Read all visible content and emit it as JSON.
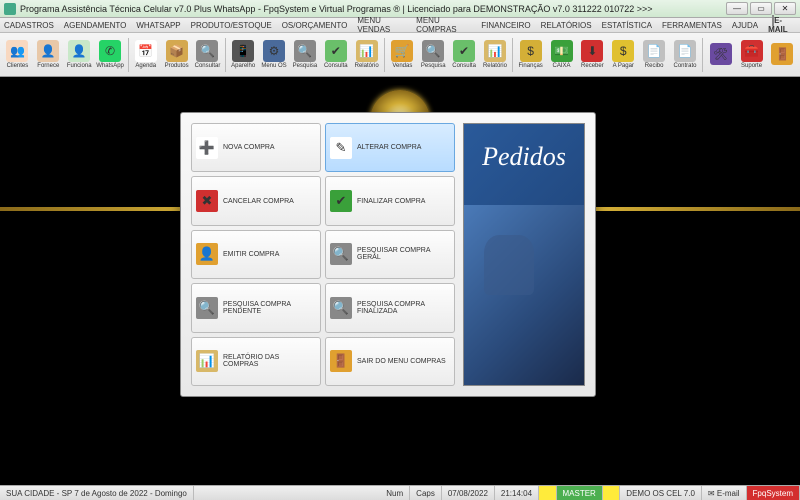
{
  "title": "Programa Assistência Técnica Celular v7.0 Plus WhatsApp - FpqSystem e Virtual Programas ® | Licenciado para  DEMONSTRAÇÃO v7.0 311222 010722 >>>",
  "menu": [
    "CADASTROS",
    "AGENDAMENTO",
    "WHATSAPP",
    "PRODUTO/ESTOQUE",
    "OS/ORÇAMENTO",
    "MENU VENDAS",
    "MENU COMPRAS",
    "FINANCEIRO",
    "RELATÓRIOS",
    "ESTATÍSTICA",
    "FERRAMENTAS",
    "AJUDA"
  ],
  "email_label": "E-MAIL",
  "toolbar": [
    {
      "label": "Clientes",
      "bg": "#f8d8c0",
      "glyph": "👥"
    },
    {
      "label": "Fornece",
      "bg": "#e8c8a8",
      "glyph": "👤"
    },
    {
      "label": "Funciona",
      "bg": "#c8e8c8",
      "glyph": "👤"
    },
    {
      "label": "WhatsApp",
      "bg": "#25d366",
      "glyph": "✆"
    },
    {
      "label": "Agenda",
      "bg": "#ffffff",
      "glyph": "📅"
    },
    {
      "label": "Produtos",
      "bg": "#d4a850",
      "glyph": "📦"
    },
    {
      "label": "Consultar",
      "bg": "#888888",
      "glyph": "🔍"
    },
    {
      "label": "Aparelho",
      "bg": "#555555",
      "glyph": "📱"
    },
    {
      "label": "Menu OS",
      "bg": "#4a6a9a",
      "glyph": "⚙"
    },
    {
      "label": "Pesquisa",
      "bg": "#888888",
      "glyph": "🔍"
    },
    {
      "label": "Consulta",
      "bg": "#6abf6a",
      "glyph": "✔"
    },
    {
      "label": "Relatório",
      "bg": "#d8b868",
      "glyph": "📊"
    },
    {
      "label": "Vendas",
      "bg": "#e0a030",
      "glyph": "🛒"
    },
    {
      "label": "Pesquisa",
      "bg": "#888888",
      "glyph": "🔍"
    },
    {
      "label": "Consulta",
      "bg": "#6abf6a",
      "glyph": "✔"
    },
    {
      "label": "Relatório",
      "bg": "#d8b868",
      "glyph": "📊"
    },
    {
      "label": "Finanças",
      "bg": "#d4af37",
      "glyph": "$"
    },
    {
      "label": "CAIXA",
      "bg": "#3aa03a",
      "glyph": "💵"
    },
    {
      "label": "Receber",
      "bg": "#d03030",
      "glyph": "⬇"
    },
    {
      "label": "A Pagar",
      "bg": "#e0c030",
      "glyph": "$"
    },
    {
      "label": "Recibo",
      "bg": "#c0c0c0",
      "glyph": "📄"
    },
    {
      "label": "Contrato",
      "bg": "#c0c0c0",
      "glyph": "📄"
    },
    {
      "label": "",
      "bg": "#6a4aa0",
      "glyph": "🛠"
    },
    {
      "label": "Suporte",
      "bg": "#d03030",
      "glyph": "🧰"
    },
    {
      "label": "",
      "bg": "#e0a030",
      "glyph": "🚪"
    }
  ],
  "dialog": {
    "side_title": "Pedidos",
    "buttons": [
      {
        "label": "NOVA COMPRA",
        "glyph": "➕",
        "ibg": "#fff",
        "selected": false
      },
      {
        "label": "ALTERAR COMPRA",
        "glyph": "✎",
        "ibg": "#fff",
        "selected": true
      },
      {
        "label": "CANCELAR COMPRA",
        "glyph": "✖",
        "ibg": "#d03030",
        "selected": false
      },
      {
        "label": "FINALIZAR COMPRA",
        "glyph": "✔",
        "ibg": "#3aa03a",
        "selected": false
      },
      {
        "label": "EMITIR COMPRA",
        "glyph": "👤",
        "ibg": "#e0a030",
        "selected": false
      },
      {
        "label": "PESQUISAR COMPRA GERAL",
        "glyph": "🔍",
        "ibg": "#888",
        "selected": false
      },
      {
        "label": "PESQUISA COMPRA PENDENTE",
        "glyph": "🔍",
        "ibg": "#888",
        "selected": false
      },
      {
        "label": "PESQUISA COMPRA FINALIZADA",
        "glyph": "🔍",
        "ibg": "#888",
        "selected": false
      },
      {
        "label": "RELATÓRIO DAS COMPRAS",
        "glyph": "📊",
        "ibg": "#d8b868",
        "selected": false
      },
      {
        "label": "SAIR DO MENU COMPRAS",
        "glyph": "🚪",
        "ibg": "#e0a030",
        "selected": false
      }
    ]
  },
  "status": {
    "location": "SUA CIDADE - SP  7 de Agosto de 2022 - Domingo",
    "num": "Num",
    "caps": "Caps",
    "date": "07/08/2022",
    "time": "21:14:04",
    "master": "MASTER",
    "demo": "DEMO OS CEL 7.0",
    "email": "E-mail",
    "brand": "FpqSystem"
  }
}
